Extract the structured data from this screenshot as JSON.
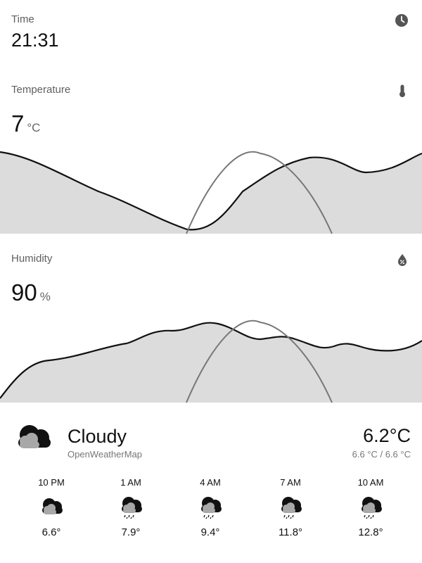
{
  "time_card": {
    "label": "Time",
    "value": "21:31",
    "icon": "clock-icon"
  },
  "temperature_card": {
    "label": "Temperature",
    "value": "7",
    "unit": "°C",
    "icon": "thermometer-icon"
  },
  "humidity_card": {
    "label": "Humidity",
    "value": "90",
    "unit": "%",
    "icon": "water-percent-icon"
  },
  "weather": {
    "condition": "Cloudy",
    "provider": "OpenWeatherMap",
    "temperature": "6.2°C",
    "range": "6.6 °C / 6.6 °C",
    "icon": "cloudy-icon"
  },
  "forecast": [
    {
      "time": "10 PM",
      "temp": "6.6°",
      "icon": "cloudy-icon"
    },
    {
      "time": "1 AM",
      "temp": "7.9°",
      "icon": "rainy-icon"
    },
    {
      "time": "4 AM",
      "temp": "9.4°",
      "icon": "rainy-icon"
    },
    {
      "time": "7 AM",
      "temp": "11.8°",
      "icon": "rainy-icon"
    },
    {
      "time": "10 AM",
      "temp": "12.8°",
      "icon": "rainy-icon"
    }
  ],
  "colors": {
    "graph_fill": "#dcdcdc",
    "graph_line": "#111111",
    "sun_line": "#777777"
  }
}
